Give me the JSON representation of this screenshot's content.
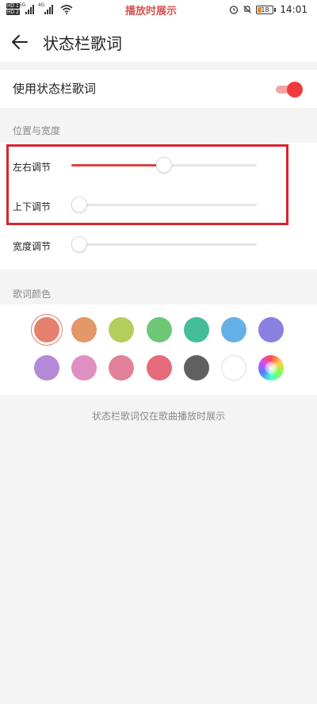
{
  "status_bar": {
    "hd1": "HD 1",
    "hd2": "HD 2",
    "network1": "5G",
    "network2": "4G",
    "now_playing": "播放时展示",
    "battery": "18",
    "time": "14:01"
  },
  "app_bar": {
    "title": "状态栏歌词"
  },
  "lyrics_toggle": {
    "label": "使用状态栏歌词",
    "enabled": true
  },
  "position_section": {
    "title": "位置与宽度",
    "sliders": [
      {
        "label": "左右调节",
        "value": 0.5
      },
      {
        "label": "上下调节",
        "value": 0.0
      },
      {
        "label": "宽度调节",
        "value": 0.0
      }
    ]
  },
  "color_section": {
    "title": "歌词颜色",
    "selected_index": 0,
    "colors": [
      "#e5806e",
      "#e49767",
      "#b5cd5c",
      "#6cc776",
      "#44be98",
      "#66b0e8",
      "#8a80e0",
      "#b48ad8",
      "#df8fc0",
      "#e4819a",
      "#e66b7a",
      "#606060",
      "#ffffff",
      "rainbow"
    ]
  },
  "footer_note": "状态栏歌词仅在歌曲播放时展示",
  "colors": {
    "accent": "#ef3b3b",
    "highlight_box": "#d9232e"
  }
}
